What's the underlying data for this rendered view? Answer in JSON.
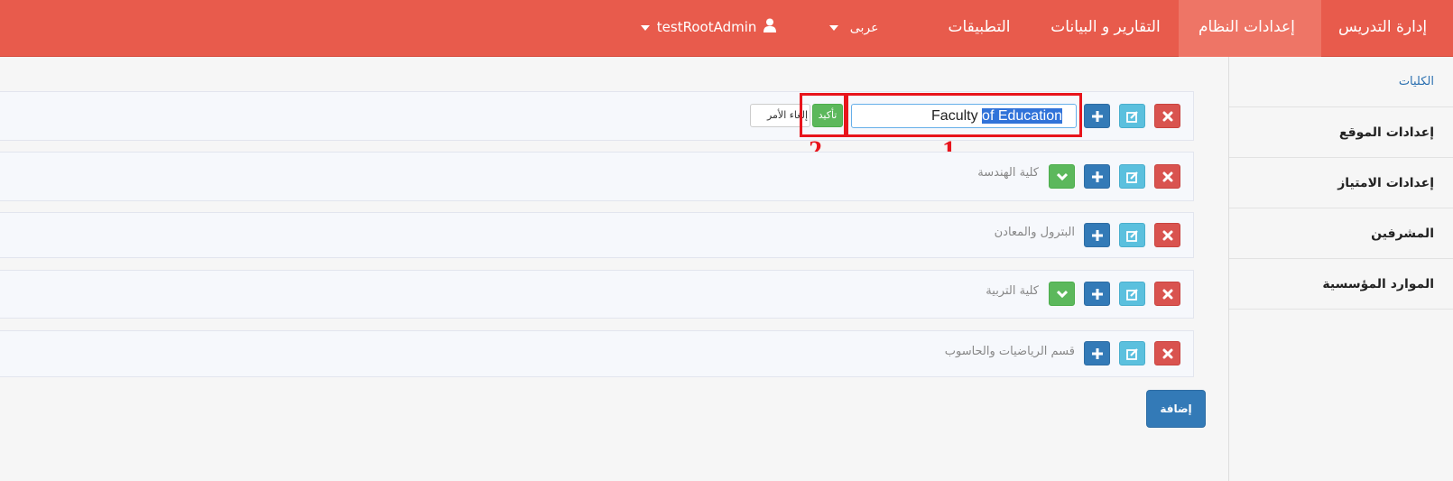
{
  "navbar": {
    "items": [
      {
        "label": "إدارة التدريس"
      },
      {
        "label": "إعدادات النظام"
      },
      {
        "label": "التقارير و البيانات"
      },
      {
        "label": "التطبيقات"
      }
    ],
    "language": "عربى",
    "user": "testRootAdmin"
  },
  "sidebar": {
    "items": [
      {
        "label": "الكليات"
      },
      {
        "label": "إعدادات الموقع"
      },
      {
        "label": "إعدادات الامتياز"
      },
      {
        "label": "المشرفين"
      },
      {
        "label": "الموارد المؤسسية"
      }
    ]
  },
  "editor": {
    "value_unselected": "Faculty ",
    "value_selected": "of Education",
    "confirm_label": "تأكيد",
    "cancel_label": "إلغاء الأمر"
  },
  "rows": [
    {
      "label": "كلية الهندسة"
    },
    {
      "label": "البترول والمعادن"
    },
    {
      "label": "كلية التربية"
    },
    {
      "label": "قسم الرياضيات والحاسوب"
    }
  ],
  "add_button_label": "إضافة",
  "annotations": {
    "one": "1",
    "two": "2"
  },
  "colors": {
    "navbar": "#e85b4c",
    "accent_blue": "#337ab7",
    "danger": "#d9534f",
    "info": "#5bc0de",
    "success": "#5cb85c",
    "annotation": "#e8141c"
  }
}
